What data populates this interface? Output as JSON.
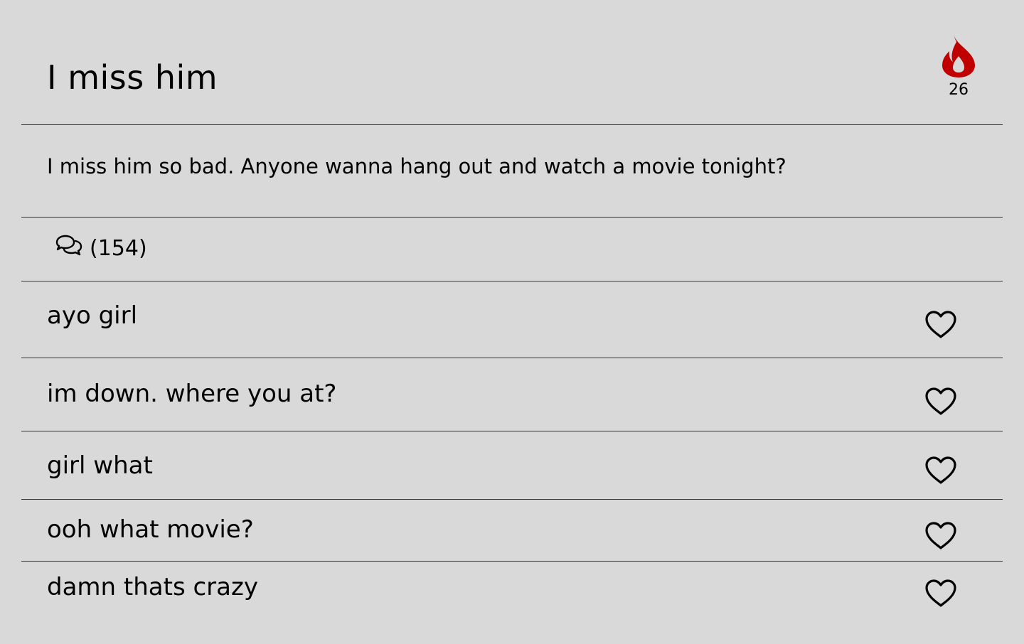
{
  "post": {
    "title": "I miss him",
    "hot_count": "26",
    "body": "I miss him so bad. Anyone wanna hang out and watch a movie tonight?",
    "comment_count": "(154)",
    "hot_color": "#c00000"
  },
  "icons": {
    "hot": "flame-icon",
    "comments": "comments-icon",
    "like": "heart-icon"
  },
  "comments": [
    {
      "text": "ayo girl"
    },
    {
      "text": "im down. where you at?"
    },
    {
      "text": "girl what"
    },
    {
      "text": "ooh what movie?"
    },
    {
      "text": "damn thats crazy"
    }
  ]
}
